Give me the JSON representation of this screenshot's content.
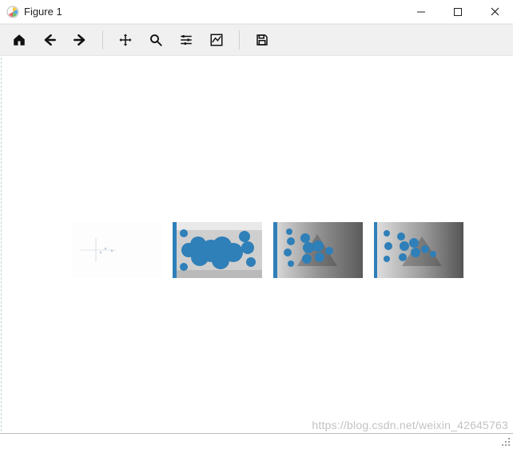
{
  "window": {
    "title": "Figure 1"
  },
  "toolbar": {
    "home_label": "Home",
    "back_label": "Back",
    "forward_label": "Forward",
    "pan_label": "Pan",
    "zoom_label": "Zoom",
    "subplots_label": "Configure subplots",
    "axes_label": "Edit axis",
    "save_label": "Save"
  },
  "watermark": "https://blog.csdn.net/weixin_42645763",
  "chart_data": [
    {
      "type": "heatmap",
      "index": 0,
      "description": "sparse mask, mostly white with faint detail"
    },
    {
      "type": "heatmap",
      "index": 1,
      "description": "dense blue keypoint overlay on grayscale scene"
    },
    {
      "type": "heatmap",
      "index": 2,
      "description": "moderate blue keypoint overlay on grayscale scene"
    },
    {
      "type": "heatmap",
      "index": 3,
      "description": "moderate blue keypoint overlay on grayscale scene"
    }
  ]
}
